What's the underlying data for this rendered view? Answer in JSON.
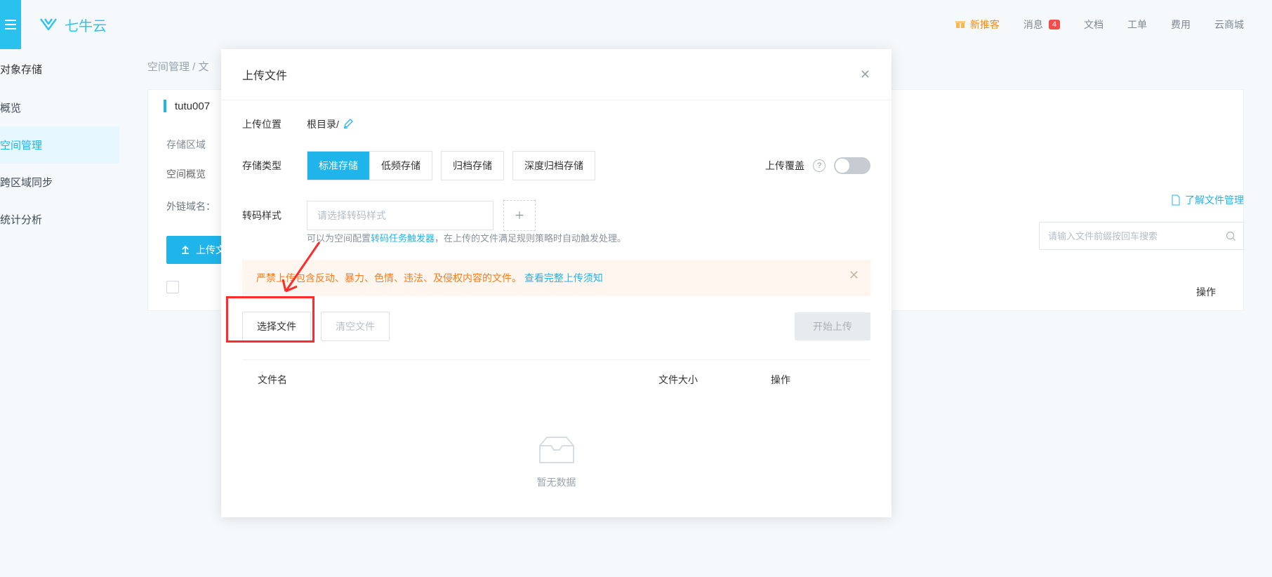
{
  "header": {
    "logo_text": "七牛云",
    "nav": {
      "new_promo": "新推客",
      "messages": "消息",
      "messages_count": "4",
      "docs": "文档",
      "tickets": "工单",
      "billing": "费用",
      "cloud_market": "云商城"
    }
  },
  "sidebar": {
    "title": "对象存储",
    "items": [
      "概览",
      "空间管理",
      "跨区域同步",
      "统计分析"
    ],
    "active_index": 1
  },
  "main": {
    "breadcrumb": "空间管理 / 文",
    "space_name": "tutu007",
    "storage_region_label": "存储区域",
    "tabs": [
      "空间概览"
    ],
    "domain_label": "外链域名：",
    "upload_button": "上传文",
    "help_link": "了解文件管理",
    "search_placeholder": "请输入文件前缀按回车搜索",
    "table": {
      "ops": "操作"
    }
  },
  "modal": {
    "title": "上传文件",
    "rows": {
      "location": {
        "label": "上传位置",
        "value": "根目录/"
      },
      "storage_type": {
        "label": "存储类型",
        "options": [
          "标准存储",
          "低频存储",
          "归档存储",
          "深度归档存储"
        ],
        "active_index": 0
      },
      "overwrite": {
        "label": "上传覆盖"
      },
      "transcode": {
        "label": "转码样式",
        "placeholder": "请选择转码样式",
        "hint_prefix": "可以为空间配置",
        "hint_link": "转码任务触发器",
        "hint_suffix": "，在上传的文件满足规则策略时自动触发处理。"
      }
    },
    "warning": {
      "text": "严禁上传包含反动、暴力、色情、违法、及侵权内容的文件。",
      "link": "查看完整上传须知"
    },
    "buttons": {
      "select_file": "选择文件",
      "clear_files": "清空文件",
      "start_upload": "开始上传"
    },
    "file_table": {
      "cols": {
        "name": "文件名",
        "size": "文件大小",
        "ops": "操作"
      },
      "empty": "暂无数据"
    }
  }
}
